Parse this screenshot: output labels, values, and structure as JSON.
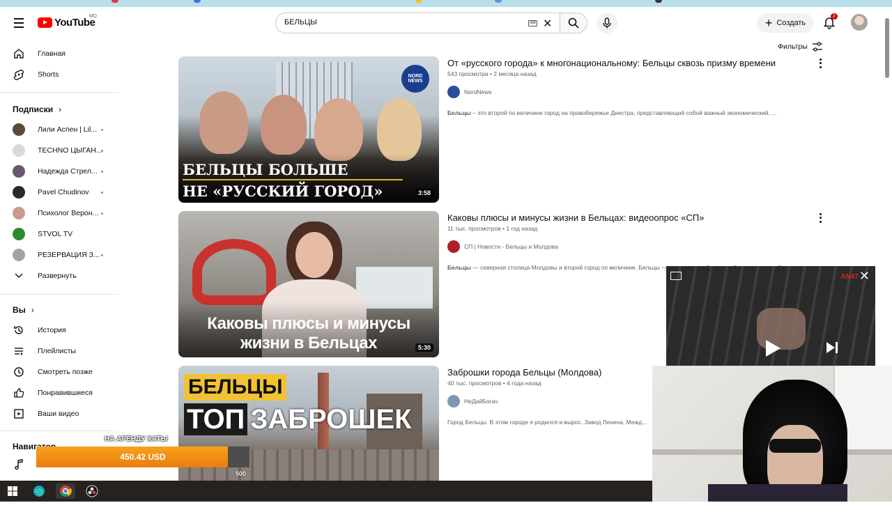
{
  "header": {
    "logo_text": "YouTube",
    "region": "MD",
    "search_value": "БЕЛЬЦЫ",
    "create_label": "Создать",
    "notifications_count": "2"
  },
  "sidebar": {
    "main": [
      {
        "label": "Главная",
        "icon": "home-icon"
      },
      {
        "label": "Shorts",
        "icon": "shorts-icon"
      }
    ],
    "subscriptions_title": "Подписки",
    "subscriptions": [
      {
        "label": "Лили Аспен | Lil...",
        "color": "#5a4a3a"
      },
      {
        "label": "TECHNO ЦЫГАН...",
        "color": "#d9d9d9"
      },
      {
        "label": "Надежда Стрел...",
        "color": "#6b5870"
      },
      {
        "label": "Pavel Chudinov",
        "color": "#2a2a2a"
      },
      {
        "label": "Психолог Верон...",
        "color": "#c99a8c"
      },
      {
        "label": "STVOL TV",
        "color": "#2d8c2d"
      },
      {
        "label": "РЕЗЕРВАЦИЯ З...",
        "color": "#a7a39c"
      }
    ],
    "expand_label": "Развернуть",
    "you_title": "Вы",
    "you_items": [
      {
        "label": "История",
        "icon": "history-icon"
      },
      {
        "label": "Плейлисты",
        "icon": "playlists-icon"
      },
      {
        "label": "Смотреть позже",
        "icon": "watch-later-icon"
      },
      {
        "label": "Понравившиеся",
        "icon": "like-icon"
      },
      {
        "label": "Ваши видео",
        "icon": "your-videos-icon"
      }
    ],
    "navigator_title": "Навигатор"
  },
  "filters_label": "Фильтры",
  "results": [
    {
      "title": "От «русского города» к многонациональному: Бельцы сквозь призму времени",
      "views": "543 просмотра",
      "age": "2 месяца назад",
      "channel": "NordNews",
      "description_bold": "Бельцы",
      "description": " – это второй по величине город на правобережье Днестра, представляющий собой важный экономический, ...",
      "duration": "3:58",
      "thumb_line1": "БЕЛЬЦЫ БОЛЬШЕ",
      "thumb_line2": "НЕ «РУССКИЙ ГОРОД»",
      "thumb_badge": "NORD NEWS"
    },
    {
      "title": "Каковы плюсы и минусы жизни в Бельцах: видеоопрос «СП»",
      "views": "11 тыс. просмотров",
      "age": "1 год назад",
      "channel": "СП | Новости - Бельцы и Молдова",
      "description_bold": "Бельцы",
      "description": " — северная столица Молдовы и второй город по величине. Бельцы — город со своей историей и многогранной ...",
      "duration": "5:30",
      "thumb_line1": "Каковы плюсы и минусы",
      "thumb_line2": "жизни в Бельцах"
    },
    {
      "title": "Заброшки города Бельцы (Молдова)",
      "views": "40 тыс. просмотров",
      "age": "4 года назад",
      "channel": "НеДайБогач",
      "description_bold": "",
      "description": "Город Бельцы. В этом городе я родился и вырос. Завод Ленина, Межд...",
      "duration": "",
      "thumb_line1": "БЕЛЬЦЫ",
      "thumb_line2": "ТОП",
      "thumb_line3": "ЗАБРОШЕК"
    }
  ],
  "mini_player": {
    "badge": "AN47"
  },
  "donation": {
    "label": "НА АРЕНДУ ХАТЫ",
    "amount": "450.42 USD",
    "goal": "500",
    "progress": 0.9
  }
}
